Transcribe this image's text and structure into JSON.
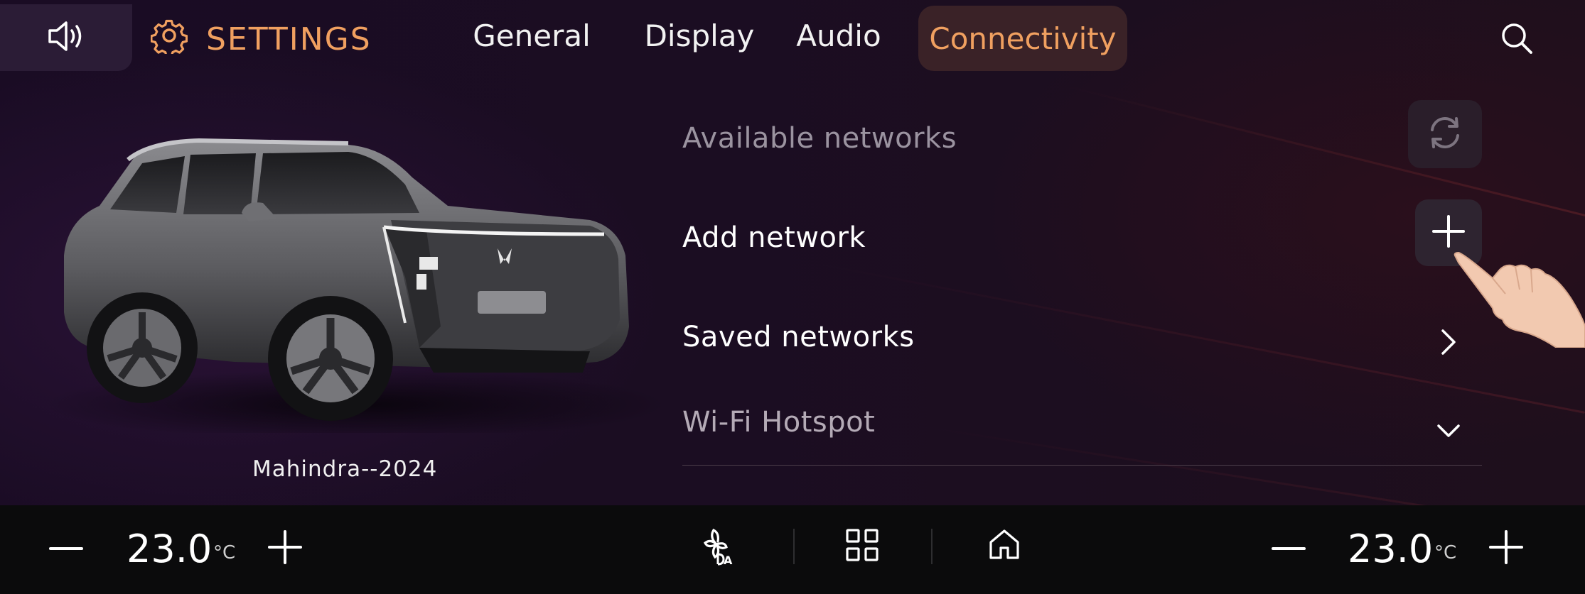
{
  "header": {
    "sound_icon": "volume-icon",
    "settings_icon": "gear-icon",
    "title": "SETTINGS",
    "tabs": [
      {
        "label": "General",
        "active": false
      },
      {
        "label": "Display",
        "active": false
      },
      {
        "label": "Audio",
        "active": false
      },
      {
        "label": "Connectivity",
        "active": true
      }
    ],
    "search_icon": "search-icon"
  },
  "vehicle": {
    "caption": "Mahindra--2024"
  },
  "connectivity": {
    "available_networks": "Available networks",
    "add_network": "Add network",
    "saved_networks": "Saved networks",
    "wifi_hotspot": "Wi-Fi Hotspot",
    "icons": {
      "refresh": "refresh-icon",
      "add": "plus-icon",
      "saved": "chevron-right-icon",
      "hotspot": "chevron-down-icon"
    }
  },
  "climate": {
    "left_temp": "23.0",
    "right_temp": "23.0",
    "unit": "°C"
  },
  "bottom_nav": {
    "icons": [
      "fan-auto-icon",
      "apps-grid-icon",
      "home-icon"
    ]
  },
  "colors": {
    "accent": "#f0a060",
    "background": "#1a0c24",
    "bottom_bar": "#0b0b0c"
  }
}
